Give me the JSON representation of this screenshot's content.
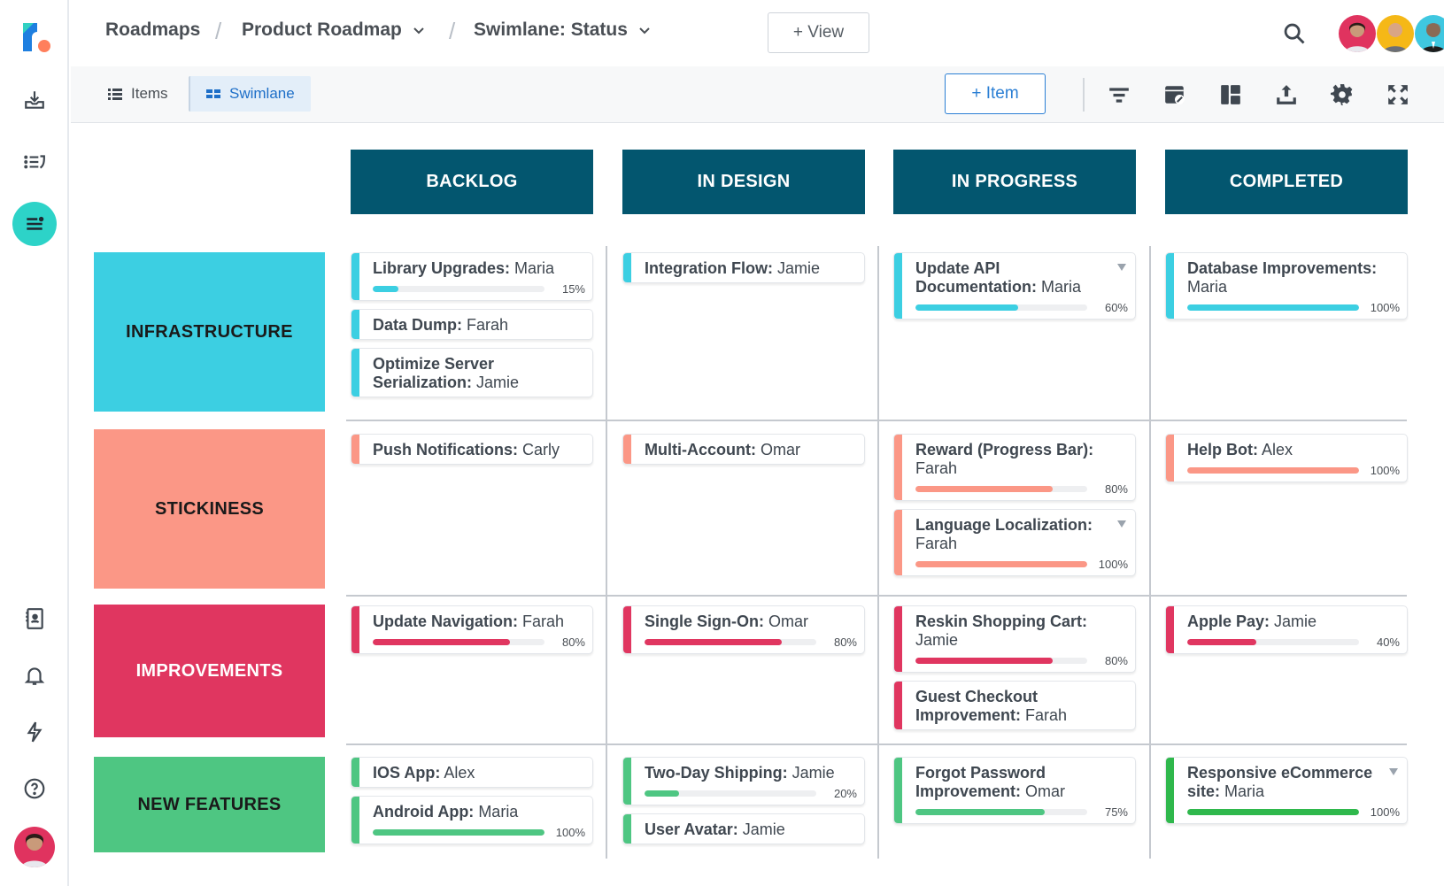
{
  "breadcrumb": {
    "root": "Roadmaps",
    "roadmap": "Product Roadmap",
    "view": "Swimlane: Status"
  },
  "header": {
    "add_view_label": "+ View",
    "avatars": [
      {
        "name": "User 1",
        "color": "#e0335f"
      },
      {
        "name": "User 2",
        "color": "#f5b817"
      },
      {
        "name": "User 3",
        "color": "#3fc7e0"
      }
    ],
    "add_user_label": "+"
  },
  "toolbar": {
    "tabs": [
      {
        "label": "Items",
        "icon": "list-icon",
        "active": false
      },
      {
        "label": "Swimlane",
        "icon": "swimlane-icon",
        "active": true
      }
    ],
    "add_item_label": "+ Item",
    "icons": [
      "filter-icon",
      "calendar-link-icon",
      "layout-icon",
      "export-icon",
      "settings-icon",
      "fullscreen-icon"
    ]
  },
  "sidebar": {
    "top_icons": [
      "import-icon",
      "list-sort-icon",
      "swimlane-view-icon"
    ],
    "bottom_icons": [
      "contacts-icon",
      "bell-icon",
      "lightning-icon",
      "help-icon"
    ],
    "active_color": "#2dd3c8"
  },
  "columns": [
    "BACKLOG",
    "IN DESIGN",
    "IN PROGRESS",
    "COMPLETED"
  ],
  "column_color": "#03566f",
  "lanes": [
    {
      "label": "INFRASTRUCTURE",
      "color": "#3ccfe2",
      "text_color": "#1a1a1a"
    },
    {
      "label": "STICKINESS",
      "color": "#fb9786",
      "text_color": "#1a1a1a"
    },
    {
      "label": "IMPROVEMENTS",
      "color": "#e03660",
      "text_color": "#ffffff"
    },
    {
      "label": "NEW FEATURES",
      "color": "#4ec682",
      "text_color": "#1a1a1a"
    }
  ],
  "cards": [
    {
      "lane": 0,
      "col": 0,
      "title": "Library Upgrades:",
      "owner": "Maria",
      "progress": 15,
      "progress_label": "15%",
      "caret": false
    },
    {
      "lane": 0,
      "col": 0,
      "title": "Data Dump:",
      "owner": "Farah",
      "progress": null,
      "caret": false
    },
    {
      "lane": 0,
      "col": 0,
      "title": "Optimize Server Serialization:",
      "owner": "Jamie",
      "progress": null,
      "caret": false
    },
    {
      "lane": 0,
      "col": 1,
      "title": "Integration Flow:",
      "owner": "Jamie",
      "progress": null,
      "caret": false
    },
    {
      "lane": 0,
      "col": 2,
      "title": "Update API Documentation:",
      "owner": "Maria",
      "progress": 60,
      "progress_label": "60%",
      "caret": true
    },
    {
      "lane": 0,
      "col": 3,
      "title": "Database Improvements:",
      "owner": "Maria",
      "progress": 100,
      "progress_label": "100%",
      "caret": false
    },
    {
      "lane": 1,
      "col": 0,
      "title": "Push Notifications:",
      "owner": "Carly",
      "progress": null,
      "caret": false
    },
    {
      "lane": 1,
      "col": 1,
      "title": "Multi-Account:",
      "owner": "Omar",
      "progress": null,
      "caret": false
    },
    {
      "lane": 1,
      "col": 2,
      "title": "Reward (Progress Bar):",
      "owner": "Farah",
      "progress": 80,
      "progress_label": "80%",
      "caret": false
    },
    {
      "lane": 1,
      "col": 2,
      "title": "Language Localization:",
      "owner": "Farah",
      "progress": 100,
      "progress_label": "100%",
      "caret": true
    },
    {
      "lane": 1,
      "col": 3,
      "title": "Help Bot:",
      "owner": "Alex",
      "progress": 100,
      "progress_label": "100%",
      "caret": false
    },
    {
      "lane": 2,
      "col": 0,
      "title": "Update Navigation:",
      "owner": "Farah",
      "progress": 80,
      "progress_label": "80%",
      "caret": false
    },
    {
      "lane": 2,
      "col": 1,
      "title": "Single Sign-On:",
      "owner": "Omar",
      "progress": 80,
      "progress_label": "80%",
      "caret": false
    },
    {
      "lane": 2,
      "col": 2,
      "title": "Reskin Shopping Cart:",
      "owner": "Jamie",
      "progress": 80,
      "progress_label": "80%",
      "caret": false
    },
    {
      "lane": 2,
      "col": 2,
      "title": "Guest Checkout Improvement:",
      "owner": "Farah",
      "progress": null,
      "caret": false
    },
    {
      "lane": 2,
      "col": 3,
      "title": "Apple Pay:",
      "owner": "Jamie",
      "progress": 40,
      "progress_label": "40%",
      "caret": false
    },
    {
      "lane": 3,
      "col": 0,
      "title": "IOS App:",
      "owner": "Alex",
      "progress": null,
      "caret": false
    },
    {
      "lane": 3,
      "col": 0,
      "title": "Android App:",
      "owner": " Maria",
      "progress": 100,
      "progress_label": "100%",
      "caret": false
    },
    {
      "lane": 3,
      "col": 1,
      "title": "Two-Day Shipping:",
      "owner": "Jamie",
      "progress": 20,
      "progress_label": "20%",
      "caret": false
    },
    {
      "lane": 3,
      "col": 1,
      "title": "User Avatar:",
      "owner": "Jamie",
      "progress": null,
      "caret": false
    },
    {
      "lane": 3,
      "col": 2,
      "title": "Forgot Password Improvement:",
      "owner": "Omar",
      "progress": 75,
      "progress_label": "75%",
      "caret": false
    },
    {
      "lane": 3,
      "col": 3,
      "title": "Responsive eCommerce site:",
      "owner": "Maria",
      "progress": 100,
      "progress_label": "100%",
      "caret": true,
      "color_override": "#2fb84c"
    }
  ]
}
